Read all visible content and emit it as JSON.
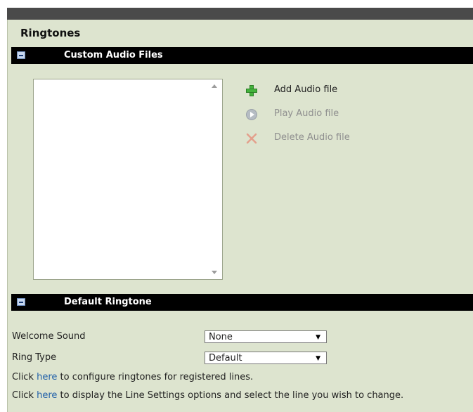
{
  "page": {
    "title": "Ringtones"
  },
  "custom_audio": {
    "title": "Custom Audio Files",
    "actions": [
      {
        "label": "Add Audio file",
        "icon": "plus-icon",
        "enabled": true,
        "color": "#3aa335"
      },
      {
        "label": "Play Audio file",
        "icon": "play-icon",
        "enabled": false,
        "color": "#a9b0b8"
      },
      {
        "label": "Delete Audio file",
        "icon": "delete-x-icon",
        "enabled": false,
        "color": "#e3a08c"
      }
    ]
  },
  "default_ringtone": {
    "title": "Default Ringtone",
    "welcome_sound": {
      "label": "Welcome Sound",
      "value": "None"
    },
    "ring_type": {
      "label": "Ring Type",
      "value": "Default"
    },
    "line1": {
      "prefix": "Click ",
      "link": "here",
      "suffix": " to configure ringtones for registered lines."
    },
    "line2": {
      "prefix": "Click ",
      "link": "here",
      "suffix": " to display the Line Settings options and select the line you wish to change."
    }
  },
  "colors": {
    "panel_bg": "#dde4cf",
    "section_bar": "#000000",
    "link": "#1f5fa8"
  }
}
